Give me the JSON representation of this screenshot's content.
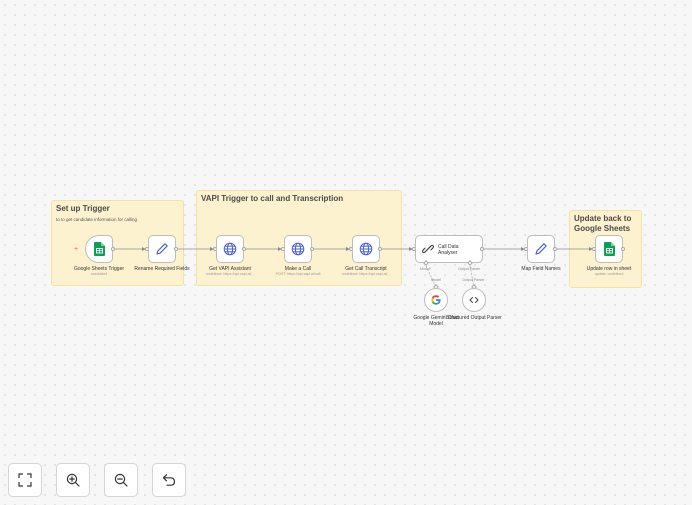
{
  "notes": {
    "setup": {
      "title": "Set up Trigger",
      "subtitle": "to to get candidate information for calling"
    },
    "vapi": {
      "title": "VAPI Trigger to call and Transcription"
    },
    "update": {
      "title": "Update back to\nGoogle Sheets"
    }
  },
  "nodes": {
    "sheets_trigger": {
      "label": "Google Sheets Trigger",
      "sublabel": "rowAdded",
      "icon": "google-sheets-icon"
    },
    "rename": {
      "label": "Rename Required Fields",
      "icon": "pencil-icon"
    },
    "get_assistant": {
      "label": "Get VAPI Assistant",
      "sublabel": "undefined: https://api.vapi.ai/...",
      "icon": "globe-icon"
    },
    "make_call": {
      "label": "Make a Call",
      "sublabel": "POST: https://api.vapi.ai/call",
      "icon": "globe-icon"
    },
    "get_transcript": {
      "label": "Get Call Transcript",
      "sublabel": "undefined: https://api.vapi.ai/...",
      "icon": "globe-icon"
    },
    "analyser": {
      "label": "Call Data\nAnalyser",
      "icon": "chain-link-icon",
      "model_port": "Model*",
      "parser_port": "Output Parser"
    },
    "gemini": {
      "label": "Google Gemini Chat Model",
      "icon": "google-g-icon",
      "port": "Model"
    },
    "structured": {
      "label": "Structured Output Parser",
      "icon": "code-brackets-icon",
      "port": "Output Parser"
    },
    "map_fields": {
      "label": "Map Field Names",
      "icon": "pencil-icon"
    },
    "update_row": {
      "label": "Update row in sheet",
      "sublabel": "update: undefined",
      "icon": "google-sheets-icon"
    }
  },
  "controls": {
    "fit": "fit-view-icon",
    "zoom_in": "zoom-in-icon",
    "zoom_out": "zoom-out-icon",
    "undo": "undo-icon"
  },
  "colors": {
    "sticky": "#fdf2cf",
    "sheets_green": "#0f9d58",
    "globe_blue": "#4a5fd0",
    "pencil_blue": "#3f5bd0",
    "add_red": "#d96a5b"
  }
}
